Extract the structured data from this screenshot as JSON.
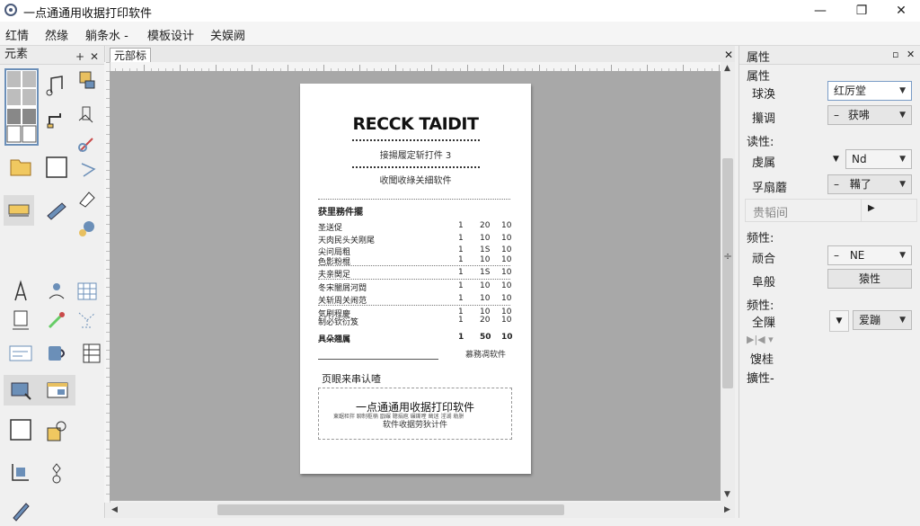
{
  "window": {
    "title": "一点通通用收据打印软件",
    "minimize_glyph": "—",
    "maximize_glyph": "❐",
    "close_glyph": "✕"
  },
  "menu": [
    {
      "label": "红情"
    },
    {
      "label": "然缘"
    },
    {
      "label": "躺条水 -"
    },
    {
      "label": "模板设计"
    },
    {
      "label": "关娱阙"
    }
  ],
  "left_panel": {
    "title": "元素",
    "pin_glyph": "+",
    "close_glyph": "✕",
    "tools": [
      "table-grid-icon",
      "music-note-icon",
      "image-crop-icon",
      "table-grid-icon",
      "faucet-icon",
      "clipboard-icon",
      "folder-tab-icon",
      "rectangle-icon",
      "triangle-icon",
      "label-icon",
      "ruler-icon",
      "gear-icon",
      "text-a-icon",
      "user-icon",
      "calendar-icon",
      "document-icon",
      "pen-icon",
      "network-icon",
      "form-icon",
      "cup-icon",
      "spreadsheet-icon",
      "image-flow-icon",
      "browser-window-icon",
      "rectangle-outline-icon",
      "speech-box-icon",
      "crop-shape-icon",
      "flowchart-icon",
      "pencil-icon"
    ]
  },
  "document": {
    "tab_label": "元部标"
  },
  "receipt": {
    "title": "RECCK TAIDIT",
    "subtitle1": "接揚履定斩打件 3",
    "subtitle2": "收聞收綠关細软件",
    "items_header": "获里務件擺",
    "rows": [
      {
        "name": "圣送促",
        "q": "1",
        "p": "20",
        "t": "10"
      },
      {
        "name": "天肉民头关刚尾",
        "q": "1",
        "p": "10",
        "t": "10"
      },
      {
        "name": "尖问局粗",
        "q": "1",
        "p": "1S",
        "t": "10"
      },
      {
        "name": "色影粉棍",
        "q": "1",
        "p": "10",
        "t": "10"
      },
      {
        "name": "夫亲関足",
        "q": "1",
        "p": "1S",
        "t": "10"
      },
      {
        "name": "冬宋闇屑河閊",
        "q": "1",
        "p": "10",
        "t": "10"
      },
      {
        "name": "关斩周关闹范",
        "q": "1",
        "p": "10",
        "t": "10"
      },
      {
        "name": "気刷程慶",
        "q": "1",
        "p": "10",
        "t": "10"
      },
      {
        "name": "制必钦衍笈",
        "q": "1",
        "p": "20",
        "t": "10"
      }
    ],
    "total_row": {
      "name": "具朵翘属",
      "q": "1",
      "p": "50",
      "t": "10"
    },
    "total_note": "慕務凋软件",
    "footer_label": "页眼来串认喳",
    "footer_title": "一点通通用收据打印软件",
    "footer_line1": "東踞秬拌 聊制枢楠 戩碾 聰捐庖 碾鐁喹 凿迷 淫湖 勑胼",
    "footer_line2": "软件收据劳狄计件"
  },
  "right_panel": {
    "title": "属性",
    "pin_glyph": "▫",
    "close_glyph": "✕",
    "sec1": "属性",
    "p_name_label": "球涣",
    "p_name_value": "红厉堂",
    "p_adjust_label": "攥调",
    "p_adjust_value": "获咈",
    "p_adjust_prefix": "–",
    "sec2": "读性:",
    "p_font_label": "虔属",
    "p_font_value": "Nd",
    "p_sub_label": "孚扇蘑",
    "p_sub_value": "鞴了",
    "p_sub_prefix": "–",
    "p_disabled_label": "贵韬间",
    "sec3": "频性:",
    "p_merge_label": "顽合",
    "p_merge_value": "NE",
    "p_merge_prefix": "–",
    "p_group_label": "阜般",
    "p_group_value": "猿性",
    "sec4": "频性:",
    "p_all_label": "全隟",
    "p_all_value": "爱蹦",
    "p_extra1": "馊桂",
    "p_extra2": "擴性-"
  }
}
